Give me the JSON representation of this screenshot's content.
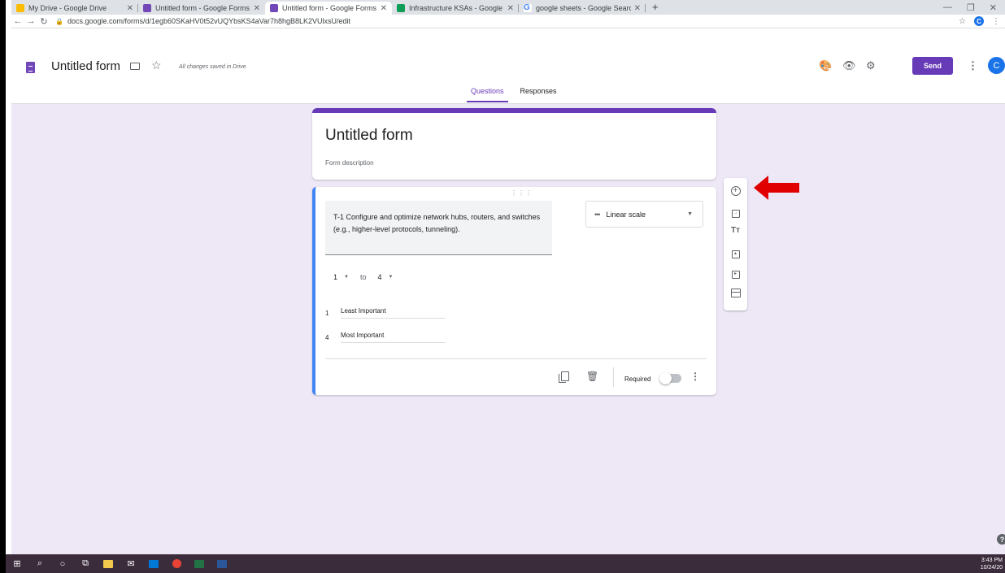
{
  "browser": {
    "tabs": [
      {
        "title": "My Drive - Google Drive",
        "color": "#fbbc04",
        "active": false
      },
      {
        "title": "Untitled form - Google Forms",
        "color": "#7248b9",
        "active": false
      },
      {
        "title": "Untitled form - Google Forms",
        "color": "#7248b9",
        "active": true
      },
      {
        "title": "Infrastructure KSAs - Google She",
        "color": "#0f9d58",
        "active": false
      },
      {
        "title": "google sheets - Google Search",
        "color": "#4285f4",
        "active": false
      }
    ],
    "url": "docs.google.com/forms/d/1egb60SKaHV0t52vUQYbsKS4aVar7h8hgB8LK2VUlxsU/edit",
    "account_initial": "C"
  },
  "header": {
    "title": "Untitled form",
    "saved_status": "All changes saved in Drive",
    "send_label": "Send",
    "avatar_initial": "C",
    "tabs": [
      "Questions",
      "Responses"
    ],
    "brand_color": "#673ab7"
  },
  "form": {
    "title": "Untitled form",
    "description_placeholder": "Form description"
  },
  "question": {
    "text": "T-1 Configure and optimize network hubs, routers, and switches (e.g., higher-level protocols, tunneling).",
    "type": "Linear scale",
    "scale_min": "1",
    "scale_to": "to",
    "scale_max": "4",
    "label_min_num": "1",
    "label_min": "Least Important",
    "label_max_num": "4",
    "label_max": "Most Important",
    "required_label": "Required",
    "required": false
  },
  "toolbar_icons": [
    "add-question-icon",
    "import-questions-icon",
    "add-title-icon",
    "add-image-icon",
    "add-video-icon",
    "add-section-icon"
  ],
  "taskbar": {
    "time": "3:43 PM",
    "date": "10/24/20"
  }
}
